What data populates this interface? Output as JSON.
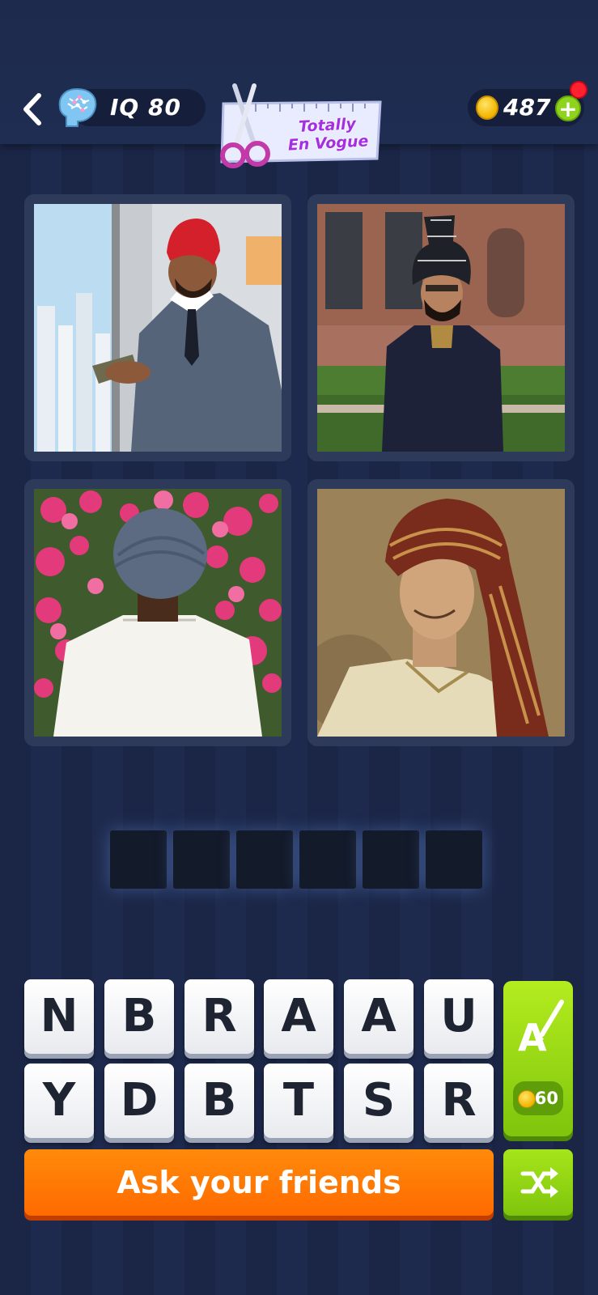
{
  "header": {
    "iq_text": "IQ 80",
    "badge_text_line1": "Totally",
    "badge_text_line2": "En Vogue",
    "coins": "487"
  },
  "puzzle": {
    "images": [
      {
        "name": "man-red-turban-suit"
      },
      {
        "name": "man-black-turban-sherwani"
      },
      {
        "name": "man-blue-turban-flowers"
      },
      {
        "name": "man-brown-turban-portrait"
      }
    ],
    "answer_length": 6
  },
  "keyboard": {
    "row1": [
      "N",
      "B",
      "R",
      "A",
      "A",
      "U"
    ],
    "row2": [
      "Y",
      "D",
      "B",
      "T",
      "S",
      "R"
    ]
  },
  "hint": {
    "price": "60"
  },
  "actions": {
    "ask_label": "Ask your friends"
  },
  "colors": {
    "background": "#1b2647",
    "accent_orange": "#ff7a00",
    "accent_green": "#8ed41c"
  }
}
